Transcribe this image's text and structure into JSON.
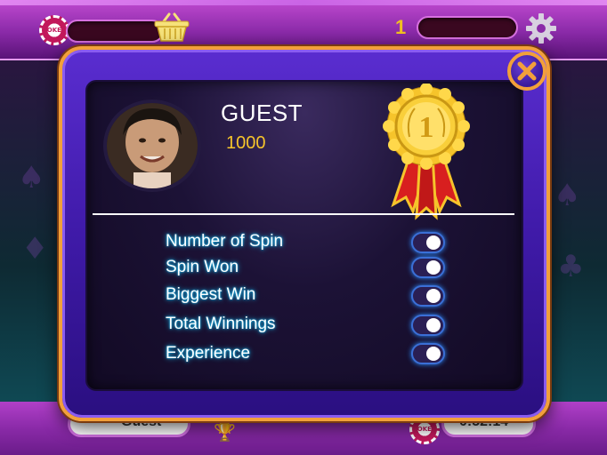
{
  "player": {
    "name": "GUEST",
    "coins": "1000"
  },
  "stats": [
    {
      "label": "Number of Spin",
      "enabled": true
    },
    {
      "label": "Spin Won",
      "enabled": true
    },
    {
      "label": "Biggest Win",
      "enabled": true
    },
    {
      "label": "Total Winnings",
      "enabled": true
    },
    {
      "label": "Experience",
      "enabled": true
    }
  ],
  "topbar": {
    "level": "1",
    "chip_text": "POKER"
  },
  "bottombar": {
    "name": "Guest",
    "timer": "0:52:14",
    "chip_text": "POKER"
  },
  "medal": {
    "rank": "1"
  },
  "colors": {
    "frame_gold": "#f2a03a",
    "modal_purple": "#3f1aa8",
    "coin_yellow": "#f6c42b",
    "glow_cyan": "#18c7ff"
  }
}
